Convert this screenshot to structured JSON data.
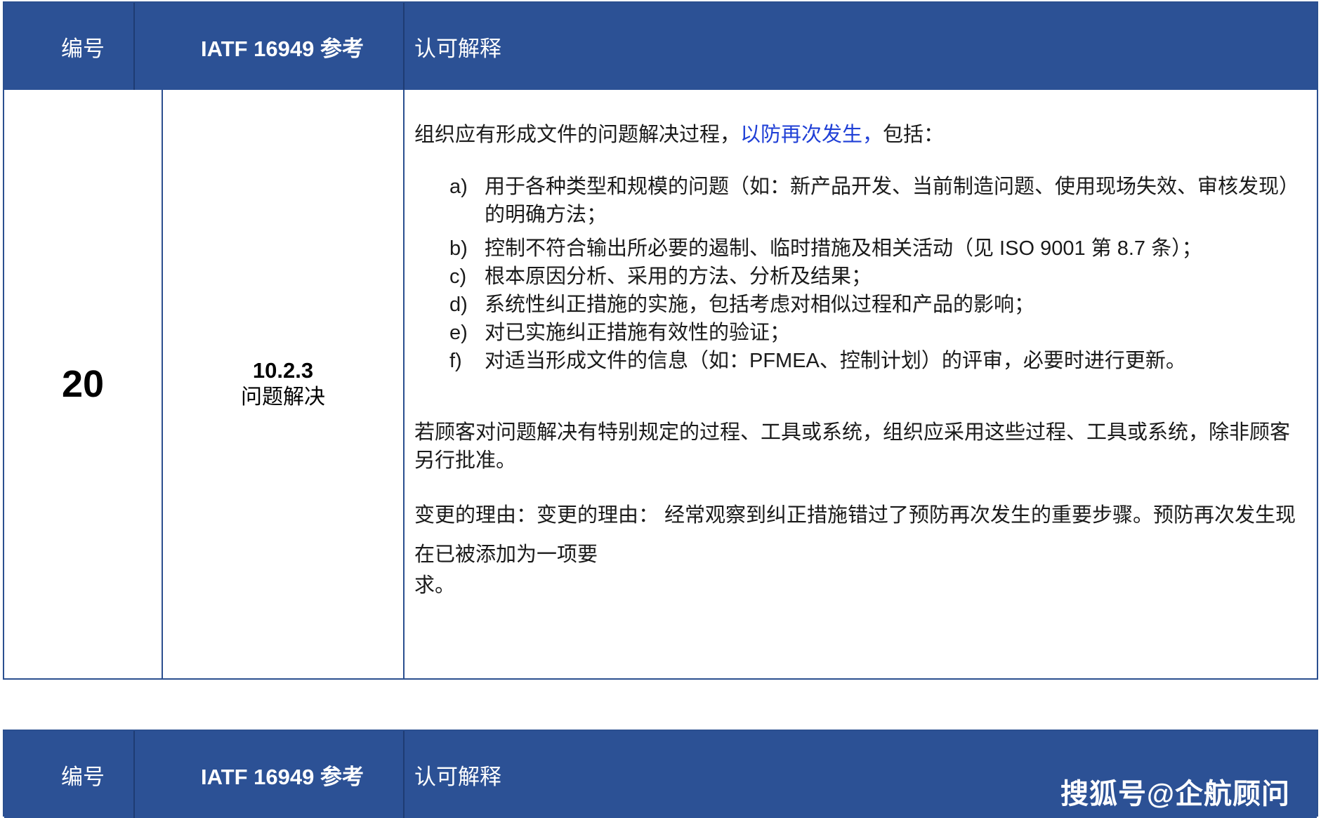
{
  "header": {
    "col_number": "编号",
    "col_reference": "IATF 16949 参考",
    "col_interpretation": "认可解释"
  },
  "row": {
    "number": "20",
    "clause": "10.2.3",
    "clause_title": "问题解决",
    "intro_prefix": "组织应有形成文件的问题解决过程，",
    "intro_highlight": "以防再次发生，",
    "intro_suffix": "包括：",
    "items": [
      {
        "label": "a)",
        "text": "用于各种类型和规模的问题（如：新产品开发、当前制造问题、使用现场失效、审核发现）的明确方法；"
      },
      {
        "label": "b)",
        "text": "控制不符合输出所必要的遏制、临时措施及相关活动（见 ISO 9001 第 8.7 条）；"
      },
      {
        "label": "c)",
        "text": "根本原因分析、采用的方法、分析及结果；"
      },
      {
        "label": "d)",
        "text": "系统性纠正措施的实施，包括考虑对相似过程和产品的影响；"
      },
      {
        "label": "e)",
        "text": "对已实施纠正措施有效性的验证；"
      },
      {
        "label": "f)",
        "text": "对适当形成文件的信息（如：PFMEA、控制计划）的评审，必要时进行更新。"
      }
    ],
    "customer_paragraph": "若顾客对问题解决有特别规定的过程、工具或系统，组织应采用这些过程、工具或系统，除非顾客另行批准。",
    "change_reason": "变更的理由：变更的理由： 经常观察到纠正措施错过了预防再次发生的重要步骤。预防再次发生现在已被添加为一项要",
    "change_reason_tail": "求。"
  },
  "watermark": "搜狐号@企航顾问",
  "colors": {
    "header_bg": "#2c5195",
    "border": "#2b4f8f",
    "highlight": "#1f3fd6"
  }
}
